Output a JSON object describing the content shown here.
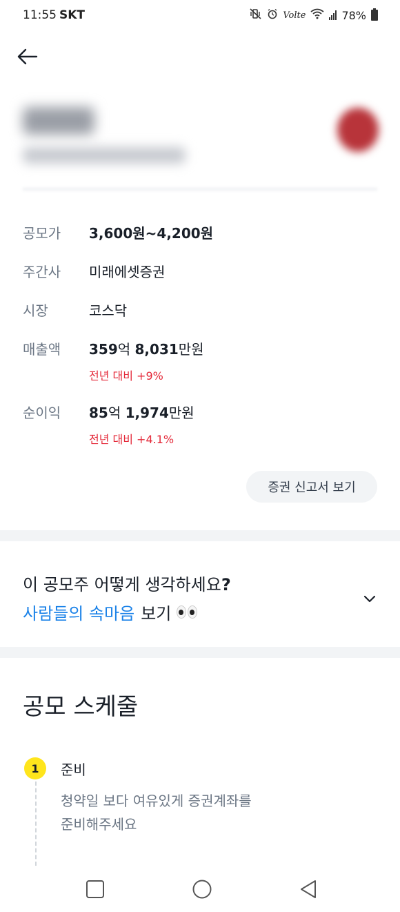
{
  "status_bar": {
    "time": "11:55",
    "carrier": "SKT",
    "volte": "Volte",
    "battery": "78%",
    "icons": [
      "mute-vibrate-icon",
      "alarm-icon",
      "volte-icon",
      "wifi-icon",
      "signal-icon",
      "battery-icon"
    ]
  },
  "nav": {
    "back_icon": "arrow-left-icon"
  },
  "info": {
    "price_label": "공모가",
    "price_value": "3,600원~4,200원",
    "underwriter_label": "주간사",
    "underwriter_value": "미래에셋증권",
    "market_label": "시장",
    "market_value": "코스닥",
    "revenue_label": "매출액",
    "revenue_num1": "359",
    "revenue_unit1": "억 ",
    "revenue_num2": "8,031",
    "revenue_unit2": "만원",
    "revenue_change": "전년 대비 +9%",
    "profit_label": "순이익",
    "profit_num1": "85",
    "profit_unit1": "억 ",
    "profit_num2": "1,974",
    "profit_unit2": "만원",
    "profit_change": "전년 대비 +4.1%",
    "report_button": "증권 신고서 보기"
  },
  "opinion": {
    "question_text": "이 공모주 어떻게 생각하세요",
    "question_mark": "?",
    "link_text": "사람들의 속마음",
    "link_rest": "보기",
    "eyes_icon": "eyes-emoji-icon",
    "chevron_icon": "chevron-down-icon"
  },
  "schedule": {
    "title": "공모 스케줄",
    "steps": [
      {
        "number": "1",
        "title": "준비",
        "desc_line1": "청약일 보다 여유있게 증권계좌를",
        "desc_line2": "준비해주세요"
      }
    ]
  },
  "system_nav": {
    "icons": [
      "recents-square-icon",
      "home-circle-icon",
      "back-triangle-icon"
    ]
  },
  "colors": {
    "positive_change": "#e42939",
    "link": "#1b82e8",
    "badge": "#ffe51c",
    "section_gap": "#f2f4f6"
  }
}
